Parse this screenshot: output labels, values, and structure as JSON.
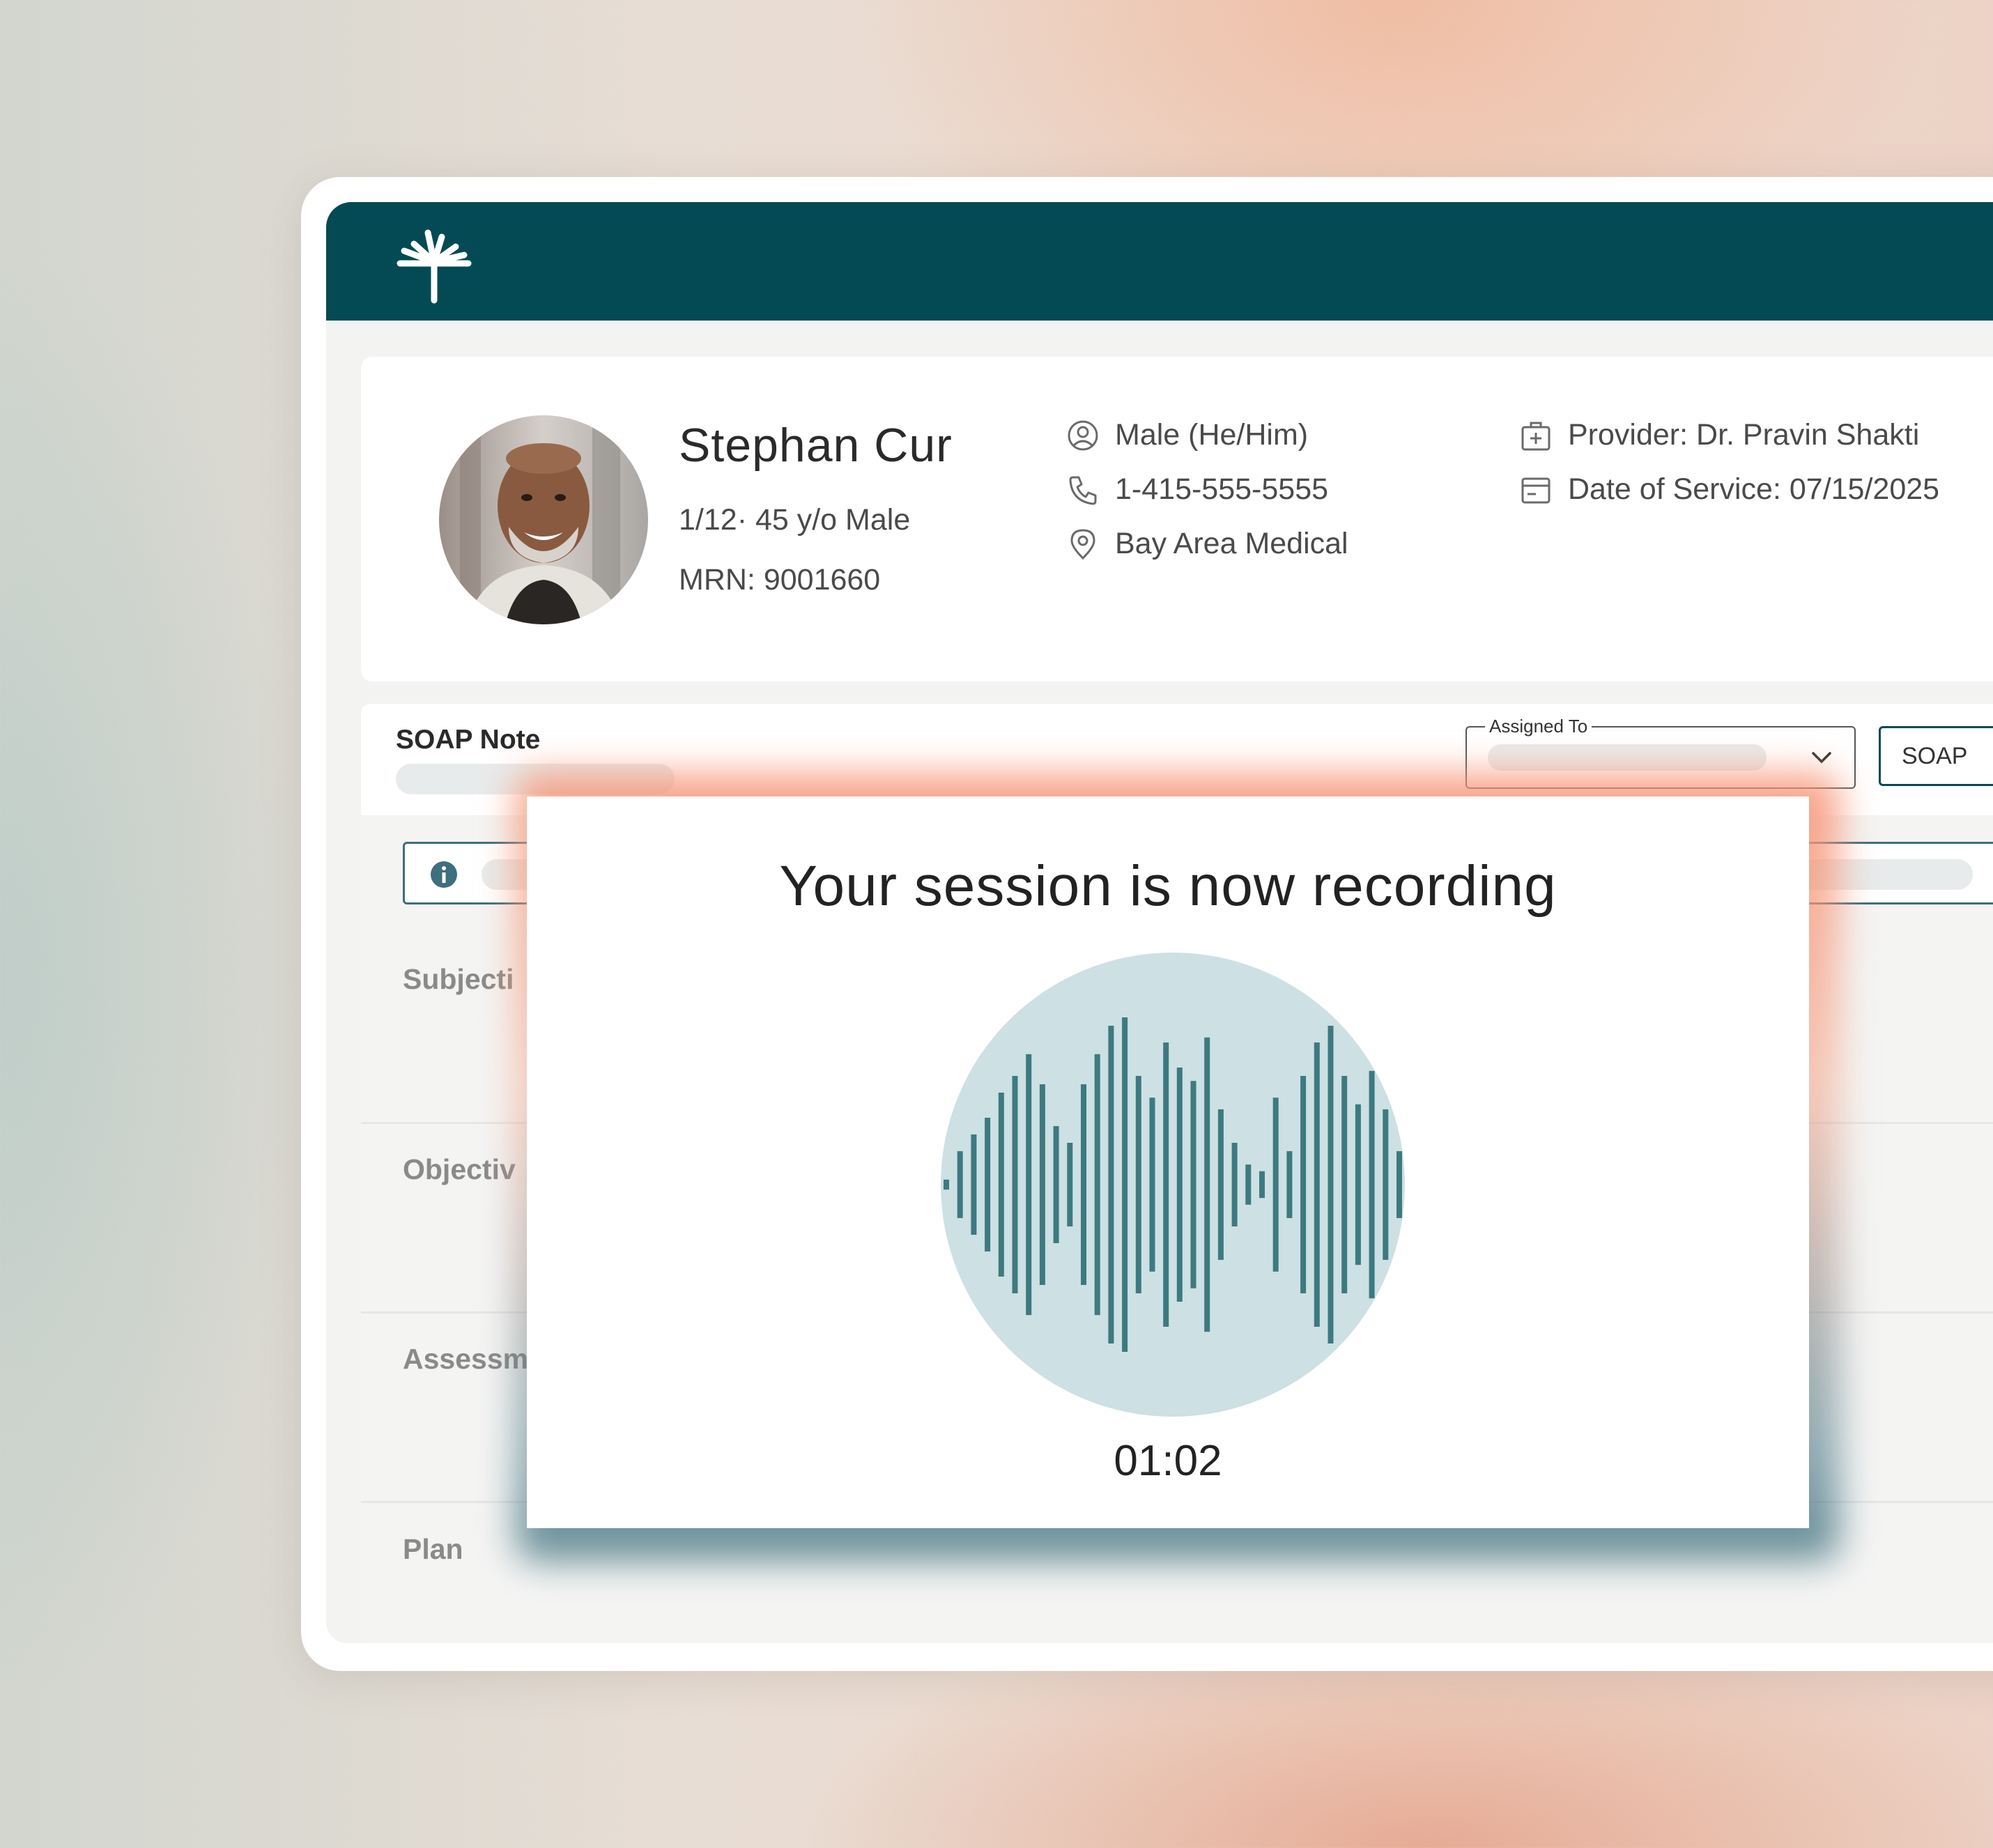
{
  "patient": {
    "name": "Stephan Cur",
    "details": "1/12· 45 y/o Male",
    "mrn": "MRN: 9001660",
    "gender": "Male (He/Him)",
    "phone": "1-415-555-5555",
    "location": "Bay Area Medical",
    "provider": "Provider: Dr. Pravin Shakti",
    "date_of_service": "Date of Service: 07/15/2025"
  },
  "soap": {
    "title": "SOAP Note",
    "assigned_to_label": "Assigned To",
    "type_button": "SOAP",
    "sections": [
      "Subjecti",
      "Objectiv",
      "Assessm",
      "Plan"
    ]
  },
  "recording": {
    "title": "Your session is now recording",
    "timer": "01:02"
  },
  "colors": {
    "brand": "#034a55",
    "wave": "#3d7a80",
    "wave_bg": "#cde0e3"
  },
  "waveform_levels": [
    0.03,
    0.2,
    0.3,
    0.4,
    0.55,
    0.65,
    0.78,
    0.6,
    0.35,
    0.25,
    0.6,
    0.78,
    0.95,
    1.0,
    0.65,
    0.52,
    0.85,
    0.7,
    0.62,
    0.88,
    0.45,
    0.25,
    0.12,
    0.08,
    0.52,
    0.2,
    0.65,
    0.85,
    0.95,
    0.65,
    0.48,
    0.68,
    0.45,
    0.2
  ]
}
